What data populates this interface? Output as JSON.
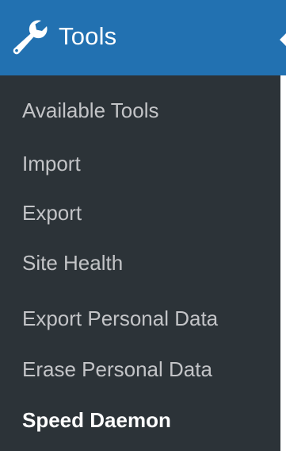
{
  "menu": {
    "title": "Tools",
    "icon": "wrench-icon",
    "colors": {
      "header_bg": "#2271b1",
      "submenu_bg": "#2c3338",
      "item_text": "#c3c4c7",
      "current_text": "#ffffff"
    },
    "items": [
      {
        "label": "Available Tools"
      },
      {
        "label": "Import"
      },
      {
        "label": "Export"
      },
      {
        "label": "Site Health"
      },
      {
        "label": "Export Personal Data"
      },
      {
        "label": "Erase Personal Data"
      },
      {
        "label": "Speed Daemon",
        "current": true
      }
    ]
  }
}
